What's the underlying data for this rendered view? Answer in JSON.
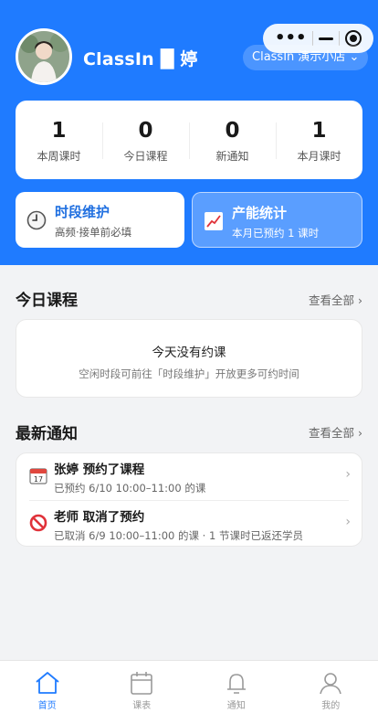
{
  "header": {
    "user_name": "ClassIn █ 婷",
    "shop_label": "ClassIn 演示小店 ⌄"
  },
  "stats": [
    {
      "value": "1",
      "label": "本周课时"
    },
    {
      "value": "0",
      "label": "今日课程"
    },
    {
      "value": "0",
      "label": "新通知"
    },
    {
      "value": "1",
      "label": "本月课时"
    }
  ],
  "quick_cards": {
    "maintenance": {
      "title": "时段维护",
      "subtitle": "高频·接单前必填",
      "icon": "clock-icon"
    },
    "capacity": {
      "title": "产能统计",
      "subtitle": "本月已预约 1 课时",
      "icon": "chart-icon"
    }
  },
  "today": {
    "title": "今日课程",
    "view_all": "查看全部 ›",
    "empty_title": "今天没有约课",
    "empty_hint": "空闲时段可前往「时段维护」开放更多可约时间"
  },
  "notices": {
    "title": "最新通知",
    "view_all": "查看全部 ›",
    "items": [
      {
        "title": "张婷 预约了课程",
        "detail": "已预约 6/10 10:00–11:00 的课",
        "icon": "calendar-icon"
      },
      {
        "title": "老师 取消了预约",
        "detail": "已取消 6/9 10:00–11:00 的课 · 1 节课时已返还学员",
        "icon": "prohibited-icon"
      }
    ]
  },
  "tabbar": [
    {
      "label": "首页",
      "icon": "home-icon"
    },
    {
      "label": "课表",
      "icon": "calendar-icon"
    },
    {
      "label": "通知",
      "icon": "bell-icon"
    },
    {
      "label": "我的",
      "icon": "user-icon"
    }
  ],
  "colors": {
    "primary": "#1f7bff",
    "background": "#f2f3f5"
  }
}
